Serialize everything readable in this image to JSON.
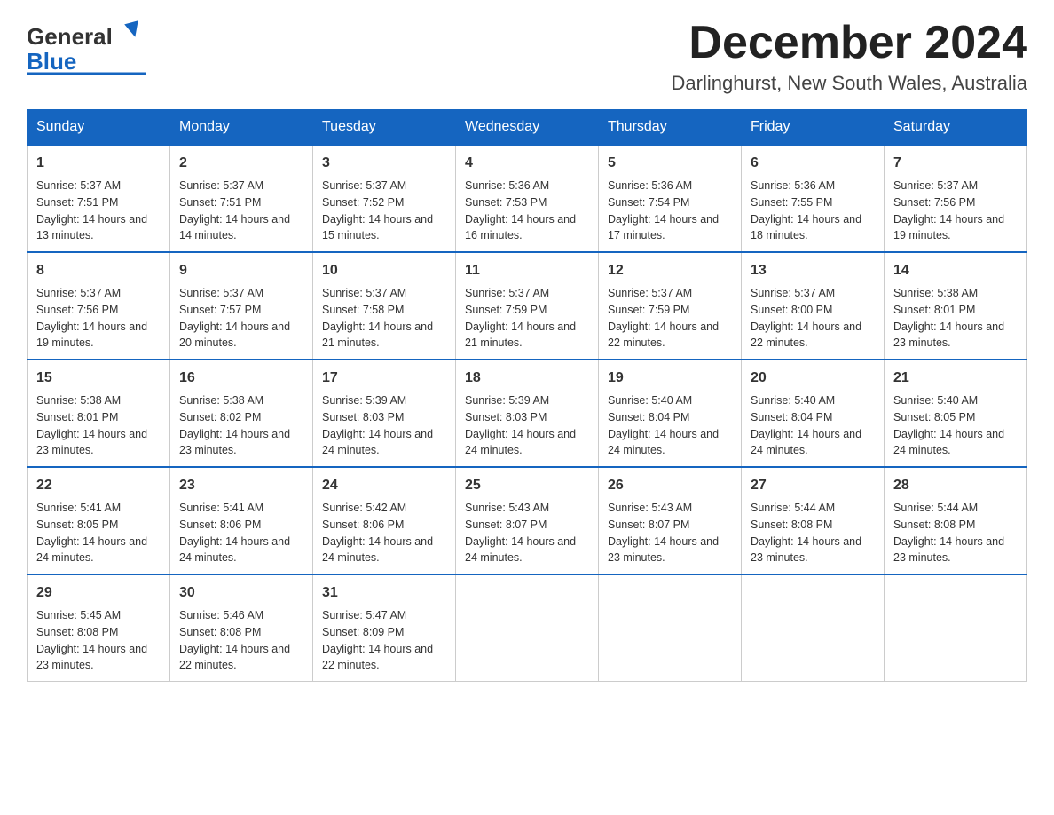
{
  "header": {
    "logo_general": "General",
    "logo_blue": "Blue",
    "month_title": "December 2024",
    "location": "Darlinghurst, New South Wales, Australia"
  },
  "weekdays": [
    "Sunday",
    "Monday",
    "Tuesday",
    "Wednesday",
    "Thursday",
    "Friday",
    "Saturday"
  ],
  "weeks": [
    [
      {
        "day": "1",
        "sunrise": "5:37 AM",
        "sunset": "7:51 PM",
        "daylight": "14 hours and 13 minutes."
      },
      {
        "day": "2",
        "sunrise": "5:37 AM",
        "sunset": "7:51 PM",
        "daylight": "14 hours and 14 minutes."
      },
      {
        "day": "3",
        "sunrise": "5:37 AM",
        "sunset": "7:52 PM",
        "daylight": "14 hours and 15 minutes."
      },
      {
        "day": "4",
        "sunrise": "5:36 AM",
        "sunset": "7:53 PM",
        "daylight": "14 hours and 16 minutes."
      },
      {
        "day": "5",
        "sunrise": "5:36 AM",
        "sunset": "7:54 PM",
        "daylight": "14 hours and 17 minutes."
      },
      {
        "day": "6",
        "sunrise": "5:36 AM",
        "sunset": "7:55 PM",
        "daylight": "14 hours and 18 minutes."
      },
      {
        "day": "7",
        "sunrise": "5:37 AM",
        "sunset": "7:56 PM",
        "daylight": "14 hours and 19 minutes."
      }
    ],
    [
      {
        "day": "8",
        "sunrise": "5:37 AM",
        "sunset": "7:56 PM",
        "daylight": "14 hours and 19 minutes."
      },
      {
        "day": "9",
        "sunrise": "5:37 AM",
        "sunset": "7:57 PM",
        "daylight": "14 hours and 20 minutes."
      },
      {
        "day": "10",
        "sunrise": "5:37 AM",
        "sunset": "7:58 PM",
        "daylight": "14 hours and 21 minutes."
      },
      {
        "day": "11",
        "sunrise": "5:37 AM",
        "sunset": "7:59 PM",
        "daylight": "14 hours and 21 minutes."
      },
      {
        "day": "12",
        "sunrise": "5:37 AM",
        "sunset": "7:59 PM",
        "daylight": "14 hours and 22 minutes."
      },
      {
        "day": "13",
        "sunrise": "5:37 AM",
        "sunset": "8:00 PM",
        "daylight": "14 hours and 22 minutes."
      },
      {
        "day": "14",
        "sunrise": "5:38 AM",
        "sunset": "8:01 PM",
        "daylight": "14 hours and 23 minutes."
      }
    ],
    [
      {
        "day": "15",
        "sunrise": "5:38 AM",
        "sunset": "8:01 PM",
        "daylight": "14 hours and 23 minutes."
      },
      {
        "day": "16",
        "sunrise": "5:38 AM",
        "sunset": "8:02 PM",
        "daylight": "14 hours and 23 minutes."
      },
      {
        "day": "17",
        "sunrise": "5:39 AM",
        "sunset": "8:03 PM",
        "daylight": "14 hours and 24 minutes."
      },
      {
        "day": "18",
        "sunrise": "5:39 AM",
        "sunset": "8:03 PM",
        "daylight": "14 hours and 24 minutes."
      },
      {
        "day": "19",
        "sunrise": "5:40 AM",
        "sunset": "8:04 PM",
        "daylight": "14 hours and 24 minutes."
      },
      {
        "day": "20",
        "sunrise": "5:40 AM",
        "sunset": "8:04 PM",
        "daylight": "14 hours and 24 minutes."
      },
      {
        "day": "21",
        "sunrise": "5:40 AM",
        "sunset": "8:05 PM",
        "daylight": "14 hours and 24 minutes."
      }
    ],
    [
      {
        "day": "22",
        "sunrise": "5:41 AM",
        "sunset": "8:05 PM",
        "daylight": "14 hours and 24 minutes."
      },
      {
        "day": "23",
        "sunrise": "5:41 AM",
        "sunset": "8:06 PM",
        "daylight": "14 hours and 24 minutes."
      },
      {
        "day": "24",
        "sunrise": "5:42 AM",
        "sunset": "8:06 PM",
        "daylight": "14 hours and 24 minutes."
      },
      {
        "day": "25",
        "sunrise": "5:43 AM",
        "sunset": "8:07 PM",
        "daylight": "14 hours and 24 minutes."
      },
      {
        "day": "26",
        "sunrise": "5:43 AM",
        "sunset": "8:07 PM",
        "daylight": "14 hours and 23 minutes."
      },
      {
        "day": "27",
        "sunrise": "5:44 AM",
        "sunset": "8:08 PM",
        "daylight": "14 hours and 23 minutes."
      },
      {
        "day": "28",
        "sunrise": "5:44 AM",
        "sunset": "8:08 PM",
        "daylight": "14 hours and 23 minutes."
      }
    ],
    [
      {
        "day": "29",
        "sunrise": "5:45 AM",
        "sunset": "8:08 PM",
        "daylight": "14 hours and 23 minutes."
      },
      {
        "day": "30",
        "sunrise": "5:46 AM",
        "sunset": "8:08 PM",
        "daylight": "14 hours and 22 minutes."
      },
      {
        "day": "31",
        "sunrise": "5:47 AM",
        "sunset": "8:09 PM",
        "daylight": "14 hours and 22 minutes."
      },
      null,
      null,
      null,
      null
    ]
  ]
}
